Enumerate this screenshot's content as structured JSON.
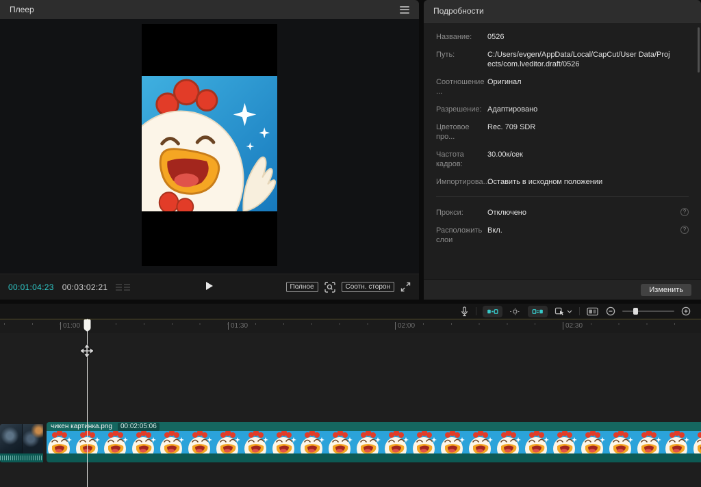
{
  "player": {
    "title": "Плеер",
    "current_time": "00:01:04:23",
    "total_time": "00:03:02:21",
    "full_button": "Полное",
    "aspect_button": "Соотн. сторон"
  },
  "details": {
    "title": "Подробности",
    "fields": [
      {
        "label": "Название:",
        "value": "0526"
      },
      {
        "label": "Путь:",
        "value": "C:/Users/evgen/AppData/Local/CapCut/User Data/Projects/com.lveditor.draft/0526"
      },
      {
        "label": "Соотношение ...",
        "value": "Оригинал"
      },
      {
        "label": "Разрешение:",
        "value": "Адаптировано"
      },
      {
        "label": "Цветовое про...",
        "value": "Rec. 709 SDR"
      },
      {
        "label": "Частота кадров:",
        "value": "30.00к/сек"
      },
      {
        "label": "Импортирова...",
        "value": "Оставить в исходном положении"
      }
    ],
    "fields2": [
      {
        "label": "Прокси:",
        "value": "Отключено"
      },
      {
        "label": "Расположить слои",
        "value": "Вкл."
      }
    ],
    "help_glyph": "?",
    "edit_button": "Изменить"
  },
  "timeline": {
    "ruler_labels": [
      "01:00",
      "01:30",
      "02:00",
      "02:30"
    ],
    "clip_name": "чикен картинка.png",
    "clip_duration": "00:02:05:06"
  },
  "colors": {
    "accent_teal": "#2fc7c7",
    "clip_header_teal": "#156760",
    "clip_strip_teal": "#0d5a54",
    "ruler_line_olive": "#5a522b"
  }
}
